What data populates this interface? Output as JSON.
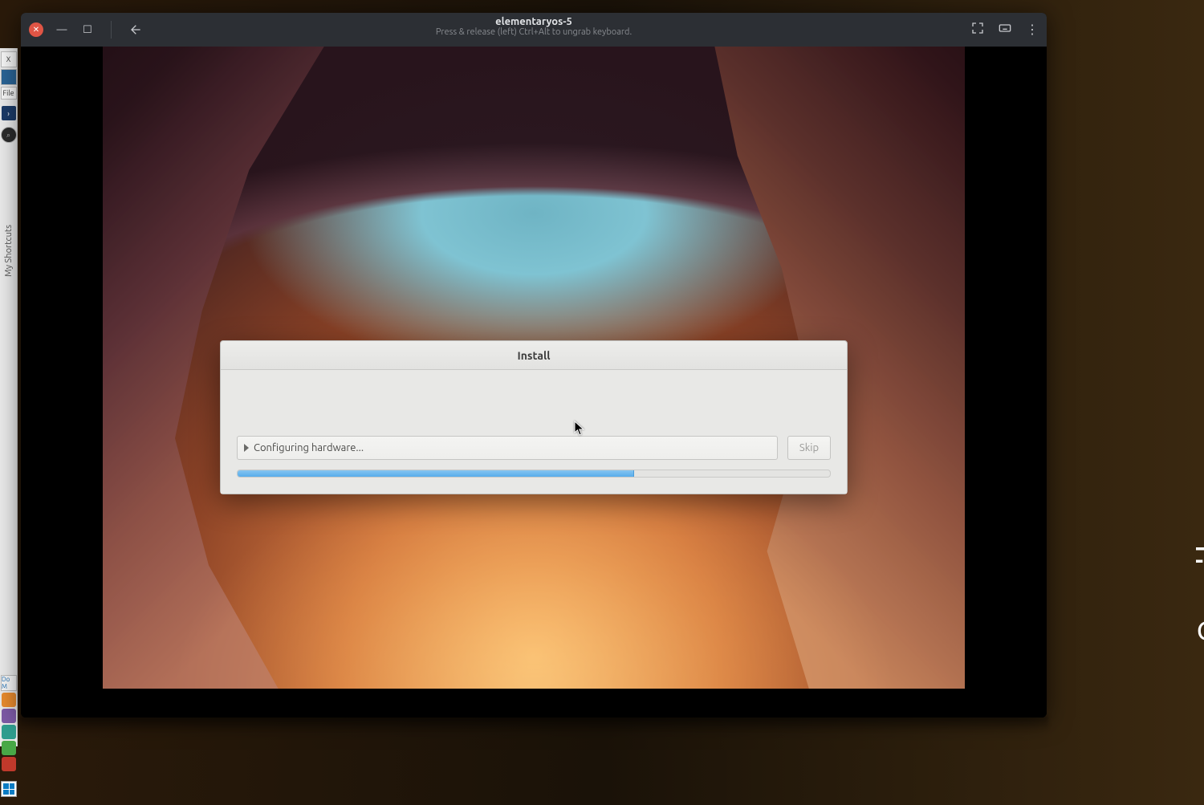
{
  "host": {
    "tab_fragment": "X",
    "file_fragment": "File",
    "shortcuts_label": "My Shortcuts",
    "do_fragment": "Do M",
    "icons": {
      "orange": "#e88b2e",
      "purple": "#7d5aa6",
      "teal": "#2f9e8f",
      "green": "#48a847",
      "red": "#c0392b"
    }
  },
  "vm": {
    "title": "elementaryos-5",
    "subtitle": "Press & release (left) Ctrl+Alt to ungrab keyboard."
  },
  "install": {
    "title": "Install",
    "status": "Configuring hardware...",
    "skip": "Skip",
    "progress_pct": 67
  }
}
